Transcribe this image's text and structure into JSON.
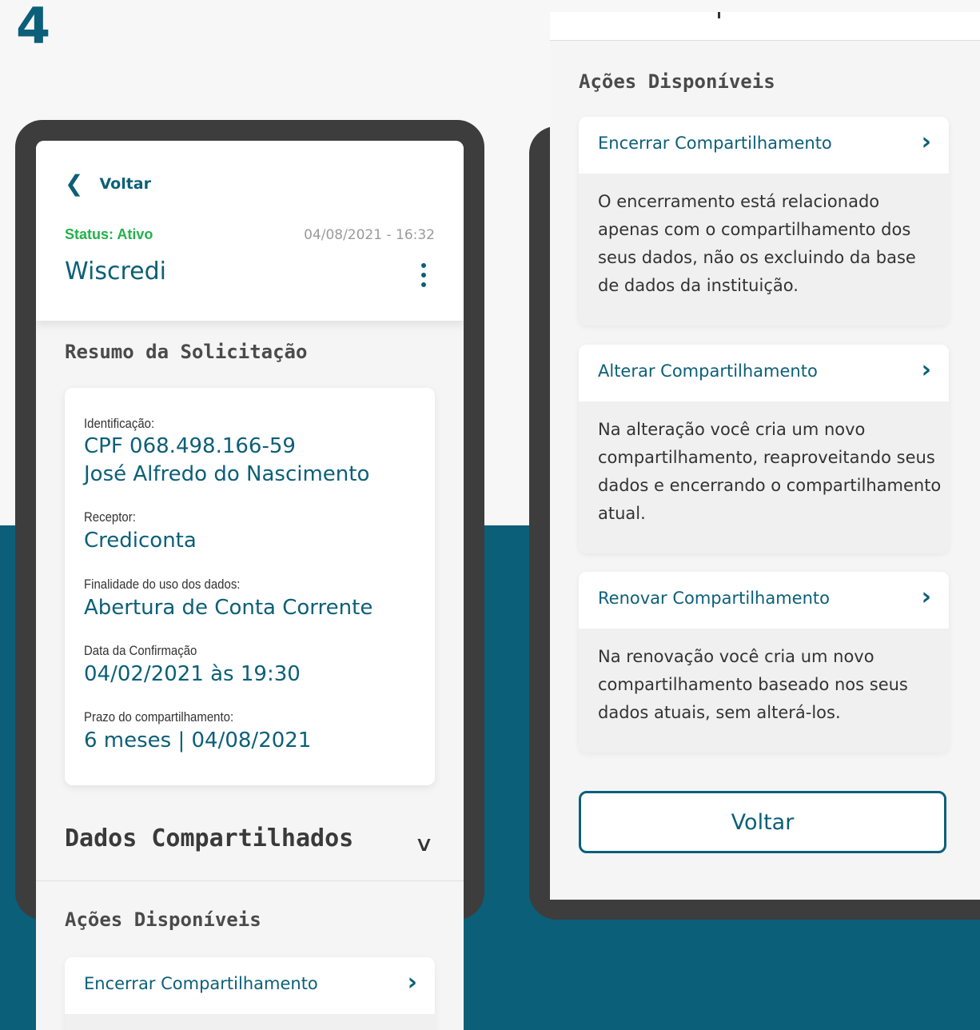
{
  "step_number": "4",
  "colors": {
    "primary": "#0c5f78",
    "status_active": "#22b24c",
    "frame": "#3d3d3d"
  },
  "left_screen": {
    "back_label": "Voltar",
    "back_icon": "chevron-left-icon",
    "status": "Status: Ativo",
    "date": "04/08/2021 - 16:32",
    "company": "Wiscredi",
    "menu_icon": "kebab-menu-icon",
    "summary_title": "Resumo da Solicitação",
    "summary": {
      "identificacao_label": "Identificação:",
      "cpf": "CPF 068.498.166-59",
      "nome": "José Alfredo do Nascimento",
      "receptor_label": "Receptor:",
      "receptor": "Crediconta",
      "finalidade_label": "Finalidade do uso dos dados:",
      "finalidade": "Abertura de Conta Corrente",
      "data_label": "Data da Confirmação",
      "data": "04/02/2021 às 19:30",
      "prazo_label": "Prazo do compartilhamento:",
      "prazo": "6 meses | 04/08/2021"
    },
    "dados_title": "Dados Compartilhados",
    "acoes_title": "Ações Disponíveis",
    "first_action": "Encerrar Compartilhamento"
  },
  "right_screen": {
    "acoes_title": "Ações Disponíveis",
    "actions": [
      {
        "title": "Encerrar Compartilhamento",
        "desc": "O encerramento está relacionado apenas com o compartilhamento dos seus dados, não os excluindo da base de dados da instituição."
      },
      {
        "title": "Alterar Compartilhamento",
        "desc": "Na alteração você cria um novo compartilhamento, reaproveitando seus dados e encerrando o compartilhamento atual."
      },
      {
        "title": "Renovar Compartilhamento",
        "desc": "Na renovação você cria um novo compartilhamento baseado nos seus dados atuais, sem alterá-los."
      }
    ],
    "voltar_button": "Voltar"
  }
}
